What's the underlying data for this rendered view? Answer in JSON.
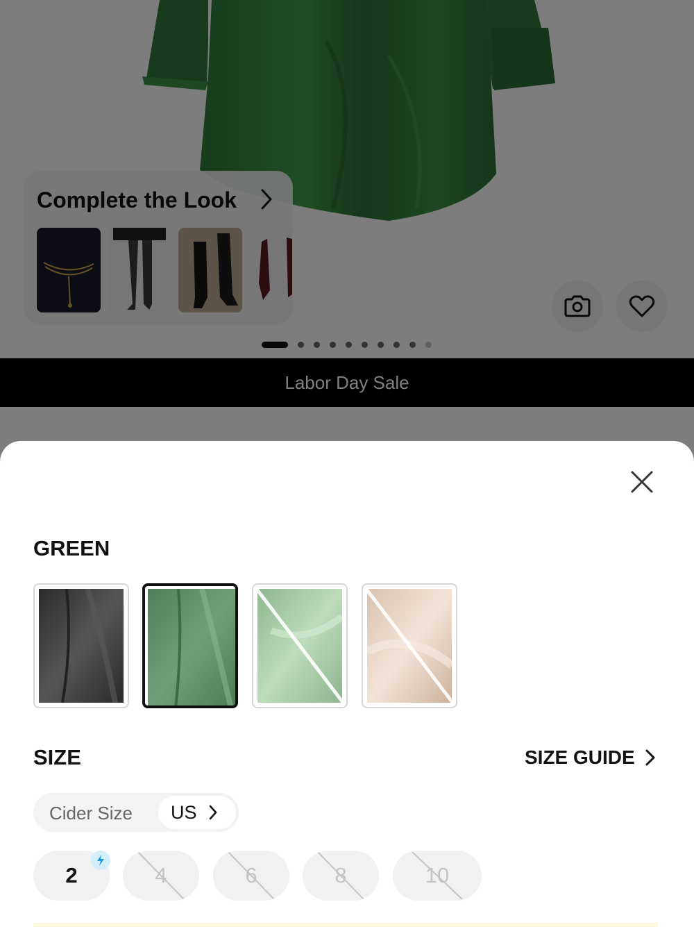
{
  "product": {
    "complete_the_look": {
      "title": "Complete the Look",
      "items": [
        "black-dress-with-chain-belt",
        "patterned-tights",
        "black-knee-boots",
        "burgundy-pointed-heels"
      ]
    },
    "actions": {
      "camera_icon": "camera-icon",
      "favorite_icon": "heart-icon"
    },
    "gallery": {
      "total_images": 10,
      "current_index": 1
    }
  },
  "banner": {
    "text": "Labor Day Sale"
  },
  "sheet": {
    "close_icon": "close-icon",
    "color": {
      "selected_name": "GREEN",
      "options": [
        {
          "name": "black",
          "hex": "#3d3d3d",
          "available": true,
          "selected": false
        },
        {
          "name": "green",
          "hex": "#5a8a64",
          "available": true,
          "selected": true
        },
        {
          "name": "sage",
          "hex": "#a8c9a8",
          "available": false,
          "selected": false
        },
        {
          "name": "champagne",
          "hex": "#e3cfbd",
          "available": false,
          "selected": false
        }
      ]
    },
    "size": {
      "title": "SIZE",
      "guide_label": "SIZE GUIDE",
      "system_label": "Cider Size",
      "system_value": "US",
      "options": [
        {
          "label": "2",
          "available": true,
          "badge": "lightning-icon"
        },
        {
          "label": "4",
          "available": false
        },
        {
          "label": "6",
          "available": false
        },
        {
          "label": "8",
          "available": false
        },
        {
          "label": "10",
          "available": false
        }
      ]
    }
  },
  "colors": {
    "accent": "#111111",
    "overlay": "rgba(0,0,0,0.5)",
    "banner_bg": "#000000",
    "badge_bg": "#d4eefa"
  }
}
